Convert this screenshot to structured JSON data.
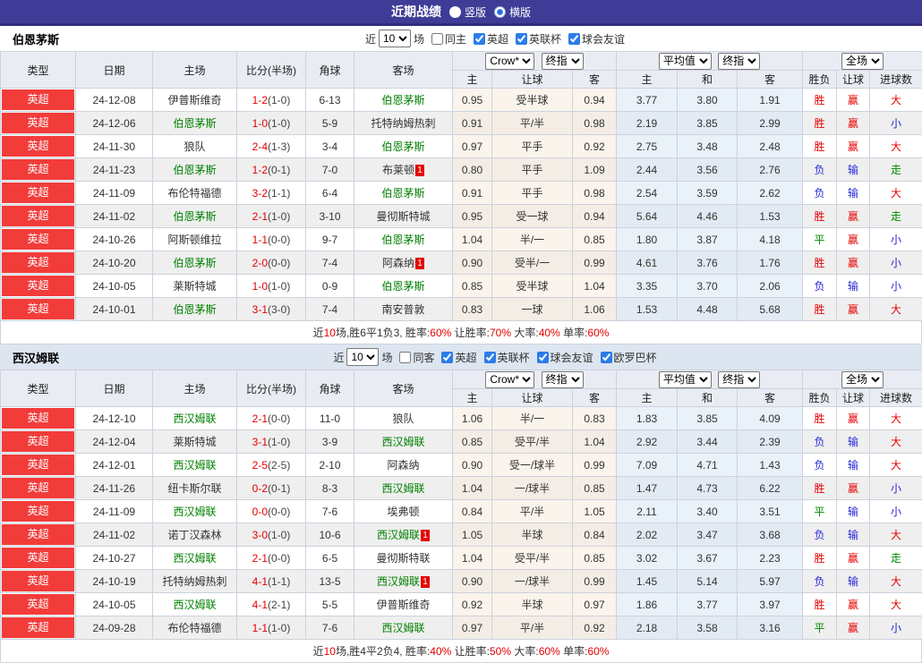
{
  "title_bar": {
    "title": "近期战绩",
    "options": [
      {
        "label": "竖版",
        "selected": false
      },
      {
        "label": "横版",
        "selected": true
      }
    ]
  },
  "colors": {
    "bar_purple": "#3e3c96",
    "badge_red": "#f23c3a",
    "win_red": "#e60000",
    "lose_blue": "#2626d8",
    "draw_green": "#008800",
    "self_team_green": "#008000",
    "header_bg": "#e9ecf3",
    "alt_filter_bg": "#dde5f0"
  },
  "table_headers": {
    "static": [
      "类型",
      "日期",
      "主场",
      "比分(半场)",
      "角球",
      "客场"
    ],
    "groups": [
      {
        "dropdowns": [
          "Crow*",
          "终指"
        ],
        "cols": [
          "主",
          "让球",
          "客"
        ]
      },
      {
        "dropdowns": [
          "平均值",
          "终指"
        ],
        "cols": [
          "主",
          "和",
          "客"
        ]
      },
      {
        "dropdowns": [
          "全场"
        ],
        "cols": [
          "胜负",
          "让球",
          "进球数"
        ]
      }
    ]
  },
  "sections": [
    {
      "team": "伯恩茅斯",
      "filter": {
        "prefix": "近",
        "matches": "10",
        "suffix": "场",
        "checkboxes": [
          {
            "label": "同主",
            "checked": false
          },
          {
            "label": "英超",
            "checked": true
          },
          {
            "label": "英联杯",
            "checked": true
          },
          {
            "label": "球会友谊",
            "checked": true
          }
        ]
      },
      "rows": [
        {
          "league": "英超",
          "date": "24-12-08",
          "home": "伊普斯维奇",
          "home_self": false,
          "home_card": "",
          "score": "1-2",
          "half": "(1-0)",
          "corners": "6-13",
          "away": "伯恩茅斯",
          "away_self": true,
          "away_card": "",
          "asia_home": "0.95",
          "handicap": "受半球",
          "asia_away": "0.94",
          "euro_home": "3.77",
          "euro_draw": "3.80",
          "euro_away": "1.91",
          "wdl": "胜",
          "wdl_c": "r",
          "hcp": "赢",
          "hcp_c": "r",
          "goal": "大",
          "goal_c": "r"
        },
        {
          "league": "英超",
          "date": "24-12-06",
          "home": "伯恩茅斯",
          "home_self": true,
          "home_card": "",
          "score": "1-0",
          "half": "(1-0)",
          "corners": "5-9",
          "away": "托特纳姆热刺",
          "away_self": false,
          "away_card": "",
          "asia_home": "0.91",
          "handicap": "平/半",
          "asia_away": "0.98",
          "euro_home": "2.19",
          "euro_draw": "3.85",
          "euro_away": "2.99",
          "wdl": "胜",
          "wdl_c": "r",
          "hcp": "赢",
          "hcp_c": "r",
          "goal": "小",
          "goal_c": "b"
        },
        {
          "league": "英超",
          "date": "24-11-30",
          "home": "狼队",
          "home_self": false,
          "home_card": "",
          "score": "2-4",
          "half": "(1-3)",
          "corners": "3-4",
          "away": "伯恩茅斯",
          "away_self": true,
          "away_card": "",
          "asia_home": "0.97",
          "handicap": "平手",
          "asia_away": "0.92",
          "euro_home": "2.75",
          "euro_draw": "3.48",
          "euro_away": "2.48",
          "wdl": "胜",
          "wdl_c": "r",
          "hcp": "赢",
          "hcp_c": "r",
          "goal": "大",
          "goal_c": "r"
        },
        {
          "league": "英超",
          "date": "24-11-23",
          "home": "伯恩茅斯",
          "home_self": true,
          "home_card": "",
          "score": "1-2",
          "half": "(0-1)",
          "corners": "7-0",
          "away": "布莱顿",
          "away_self": false,
          "away_card": "1",
          "asia_home": "0.80",
          "handicap": "平手",
          "asia_away": "1.09",
          "euro_home": "2.44",
          "euro_draw": "3.56",
          "euro_away": "2.76",
          "wdl": "负",
          "wdl_c": "b",
          "hcp": "输",
          "hcp_c": "b",
          "goal": "走",
          "goal_c": "g"
        },
        {
          "league": "英超",
          "date": "24-11-09",
          "home": "布伦特福德",
          "home_self": false,
          "home_card": "",
          "score": "3-2",
          "half": "(1-1)",
          "corners": "6-4",
          "away": "伯恩茅斯",
          "away_self": true,
          "away_card": "",
          "asia_home": "0.91",
          "handicap": "平手",
          "asia_away": "0.98",
          "euro_home": "2.54",
          "euro_draw": "3.59",
          "euro_away": "2.62",
          "wdl": "负",
          "wdl_c": "b",
          "hcp": "输",
          "hcp_c": "b",
          "goal": "大",
          "goal_c": "r"
        },
        {
          "league": "英超",
          "date": "24-11-02",
          "home": "伯恩茅斯",
          "home_self": true,
          "home_card": "",
          "score": "2-1",
          "half": "(1-0)",
          "corners": "3-10",
          "away": "曼彻斯特城",
          "away_self": false,
          "away_card": "",
          "asia_home": "0.95",
          "handicap": "受一球",
          "asia_away": "0.94",
          "euro_home": "5.64",
          "euro_draw": "4.46",
          "euro_away": "1.53",
          "wdl": "胜",
          "wdl_c": "r",
          "hcp": "赢",
          "hcp_c": "r",
          "goal": "走",
          "goal_c": "g"
        },
        {
          "league": "英超",
          "date": "24-10-26",
          "home": "阿斯顿维拉",
          "home_self": false,
          "home_card": "",
          "score": "1-1",
          "half": "(0-0)",
          "corners": "9-7",
          "away": "伯恩茅斯",
          "away_self": true,
          "away_card": "",
          "asia_home": "1.04",
          "handicap": "半/一",
          "asia_away": "0.85",
          "euro_home": "1.80",
          "euro_draw": "3.87",
          "euro_away": "4.18",
          "wdl": "平",
          "wdl_c": "g",
          "hcp": "赢",
          "hcp_c": "r",
          "goal": "小",
          "goal_c": "b"
        },
        {
          "league": "英超",
          "date": "24-10-20",
          "home": "伯恩茅斯",
          "home_self": true,
          "home_card": "",
          "score": "2-0",
          "half": "(0-0)",
          "corners": "7-4",
          "away": "阿森纳",
          "away_self": false,
          "away_card": "1",
          "asia_home": "0.90",
          "handicap": "受半/一",
          "asia_away": "0.99",
          "euro_home": "4.61",
          "euro_draw": "3.76",
          "euro_away": "1.76",
          "wdl": "胜",
          "wdl_c": "r",
          "hcp": "赢",
          "hcp_c": "r",
          "goal": "小",
          "goal_c": "b"
        },
        {
          "league": "英超",
          "date": "24-10-05",
          "home": "莱斯特城",
          "home_self": false,
          "home_card": "",
          "score": "1-0",
          "half": "(1-0)",
          "corners": "0-9",
          "away": "伯恩茅斯",
          "away_self": true,
          "away_card": "",
          "asia_home": "0.85",
          "handicap": "受半球",
          "asia_away": "1.04",
          "euro_home": "3.35",
          "euro_draw": "3.70",
          "euro_away": "2.06",
          "wdl": "负",
          "wdl_c": "b",
          "hcp": "输",
          "hcp_c": "b",
          "goal": "小",
          "goal_c": "b"
        },
        {
          "league": "英超",
          "date": "24-10-01",
          "home": "伯恩茅斯",
          "home_self": true,
          "home_card": "",
          "score": "3-1",
          "half": "(3-0)",
          "corners": "7-4",
          "away": "南安普敦",
          "away_self": false,
          "away_card": "",
          "asia_home": "0.83",
          "handicap": "一球",
          "asia_away": "1.06",
          "euro_home": "1.53",
          "euro_draw": "4.48",
          "euro_away": "5.68",
          "wdl": "胜",
          "wdl_c": "r",
          "hcp": "赢",
          "hcp_c": "r",
          "goal": "大",
          "goal_c": "r"
        }
      ],
      "summary": [
        {
          "t": "近",
          "c": "k"
        },
        {
          "t": "10",
          "c": "r"
        },
        {
          "t": "场,胜6平1负3, 胜率:",
          "c": "k"
        },
        {
          "t": "60%",
          "c": "r"
        },
        {
          "t": " 让胜率:",
          "c": "k"
        },
        {
          "t": "70%",
          "c": "r"
        },
        {
          "t": " 大率:",
          "c": "k"
        },
        {
          "t": "40%",
          "c": "r"
        },
        {
          "t": " 单率:",
          "c": "k"
        },
        {
          "t": "60%",
          "c": "r"
        }
      ]
    },
    {
      "team": "西汉姆联",
      "filter": {
        "prefix": "近",
        "matches": "10",
        "suffix": "场",
        "checkboxes": [
          {
            "label": "同客",
            "checked": false
          },
          {
            "label": "英超",
            "checked": true
          },
          {
            "label": "英联杯",
            "checked": true
          },
          {
            "label": "球会友谊",
            "checked": true
          },
          {
            "label": "欧罗巴杯",
            "checked": true
          }
        ]
      },
      "rows": [
        {
          "league": "英超",
          "date": "24-12-10",
          "home": "西汉姆联",
          "home_self": true,
          "home_card": "",
          "score": "2-1",
          "half": "(0-0)",
          "corners": "11-0",
          "away": "狼队",
          "away_self": false,
          "away_card": "",
          "asia_home": "1.06",
          "handicap": "半/一",
          "asia_away": "0.83",
          "euro_home": "1.83",
          "euro_draw": "3.85",
          "euro_away": "4.09",
          "wdl": "胜",
          "wdl_c": "r",
          "hcp": "赢",
          "hcp_c": "r",
          "goal": "大",
          "goal_c": "r"
        },
        {
          "league": "英超",
          "date": "24-12-04",
          "home": "莱斯特城",
          "home_self": false,
          "home_card": "",
          "score": "3-1",
          "half": "(1-0)",
          "corners": "3-9",
          "away": "西汉姆联",
          "away_self": true,
          "away_card": "",
          "asia_home": "0.85",
          "handicap": "受平/半",
          "asia_away": "1.04",
          "euro_home": "2.92",
          "euro_draw": "3.44",
          "euro_away": "2.39",
          "wdl": "负",
          "wdl_c": "b",
          "hcp": "输",
          "hcp_c": "b",
          "goal": "大",
          "goal_c": "r"
        },
        {
          "league": "英超",
          "date": "24-12-01",
          "home": "西汉姆联",
          "home_self": true,
          "home_card": "",
          "score": "2-5",
          "half": "(2-5)",
          "corners": "2-10",
          "away": "阿森纳",
          "away_self": false,
          "away_card": "",
          "asia_home": "0.90",
          "handicap": "受一/球半",
          "asia_away": "0.99",
          "euro_home": "7.09",
          "euro_draw": "4.71",
          "euro_away": "1.43",
          "wdl": "负",
          "wdl_c": "b",
          "hcp": "输",
          "hcp_c": "b",
          "goal": "大",
          "goal_c": "r"
        },
        {
          "league": "英超",
          "date": "24-11-26",
          "home": "纽卡斯尔联",
          "home_self": false,
          "home_card": "",
          "score": "0-2",
          "half": "(0-1)",
          "corners": "8-3",
          "away": "西汉姆联",
          "away_self": true,
          "away_card": "",
          "asia_home": "1.04",
          "handicap": "一/球半",
          "asia_away": "0.85",
          "euro_home": "1.47",
          "euro_draw": "4.73",
          "euro_away": "6.22",
          "wdl": "胜",
          "wdl_c": "r",
          "hcp": "赢",
          "hcp_c": "r",
          "goal": "小",
          "goal_c": "b"
        },
        {
          "league": "英超",
          "date": "24-11-09",
          "home": "西汉姆联",
          "home_self": true,
          "home_card": "",
          "score": "0-0",
          "half": "(0-0)",
          "corners": "7-6",
          "away": "埃弗顿",
          "away_self": false,
          "away_card": "",
          "asia_home": "0.84",
          "handicap": "平/半",
          "asia_away": "1.05",
          "euro_home": "2.11",
          "euro_draw": "3.40",
          "euro_away": "3.51",
          "wdl": "平",
          "wdl_c": "g",
          "hcp": "输",
          "hcp_c": "b",
          "goal": "小",
          "goal_c": "b"
        },
        {
          "league": "英超",
          "date": "24-11-02",
          "home": "诺丁汉森林",
          "home_self": false,
          "home_card": "",
          "score": "3-0",
          "half": "(1-0)",
          "corners": "10-6",
          "away": "西汉姆联",
          "away_self": true,
          "away_card": "1",
          "asia_home": "1.05",
          "handicap": "半球",
          "asia_away": "0.84",
          "euro_home": "2.02",
          "euro_draw": "3.47",
          "euro_away": "3.68",
          "wdl": "负",
          "wdl_c": "b",
          "hcp": "输",
          "hcp_c": "b",
          "goal": "大",
          "goal_c": "r"
        },
        {
          "league": "英超",
          "date": "24-10-27",
          "home": "西汉姆联",
          "home_self": true,
          "home_card": "",
          "score": "2-1",
          "half": "(0-0)",
          "corners": "6-5",
          "away": "曼彻斯特联",
          "away_self": false,
          "away_card": "",
          "asia_home": "1.04",
          "handicap": "受平/半",
          "asia_away": "0.85",
          "euro_home": "3.02",
          "euro_draw": "3.67",
          "euro_away": "2.23",
          "wdl": "胜",
          "wdl_c": "r",
          "hcp": "赢",
          "hcp_c": "r",
          "goal": "走",
          "goal_c": "g"
        },
        {
          "league": "英超",
          "date": "24-10-19",
          "home": "托特纳姆热刺",
          "home_self": false,
          "home_card": "",
          "score": "4-1",
          "half": "(1-1)",
          "corners": "13-5",
          "away": "西汉姆联",
          "away_self": true,
          "away_card": "1",
          "asia_home": "0.90",
          "handicap": "一/球半",
          "asia_away": "0.99",
          "euro_home": "1.45",
          "euro_draw": "5.14",
          "euro_away": "5.97",
          "wdl": "负",
          "wdl_c": "b",
          "hcp": "输",
          "hcp_c": "b",
          "goal": "大",
          "goal_c": "r"
        },
        {
          "league": "英超",
          "date": "24-10-05",
          "home": "西汉姆联",
          "home_self": true,
          "home_card": "",
          "score": "4-1",
          "half": "(2-1)",
          "corners": "5-5",
          "away": "伊普斯维奇",
          "away_self": false,
          "away_card": "",
          "asia_home": "0.92",
          "handicap": "半球",
          "asia_away": "0.97",
          "euro_home": "1.86",
          "euro_draw": "3.77",
          "euro_away": "3.97",
          "wdl": "胜",
          "wdl_c": "r",
          "hcp": "赢",
          "hcp_c": "r",
          "goal": "大",
          "goal_c": "r"
        },
        {
          "league": "英超",
          "date": "24-09-28",
          "home": "布伦特福德",
          "home_self": false,
          "home_card": "",
          "score": "1-1",
          "half": "(1-0)",
          "corners": "7-6",
          "away": "西汉姆联",
          "away_self": true,
          "away_card": "",
          "asia_home": "0.97",
          "handicap": "平/半",
          "asia_away": "0.92",
          "euro_home": "2.18",
          "euro_draw": "3.58",
          "euro_away": "3.16",
          "wdl": "平",
          "wdl_c": "g",
          "hcp": "赢",
          "hcp_c": "r",
          "goal": "小",
          "goal_c": "b"
        }
      ],
      "summary": [
        {
          "t": "近",
          "c": "k"
        },
        {
          "t": "10",
          "c": "r"
        },
        {
          "t": "场,胜4平2负4, 胜率:",
          "c": "k"
        },
        {
          "t": "40%",
          "c": "r"
        },
        {
          "t": " 让胜率:",
          "c": "k"
        },
        {
          "t": "50%",
          "c": "r"
        },
        {
          "t": " 大率:",
          "c": "k"
        },
        {
          "t": "60%",
          "c": "r"
        },
        {
          "t": " 单率:",
          "c": "k"
        },
        {
          "t": "60%",
          "c": "r"
        }
      ]
    }
  ]
}
